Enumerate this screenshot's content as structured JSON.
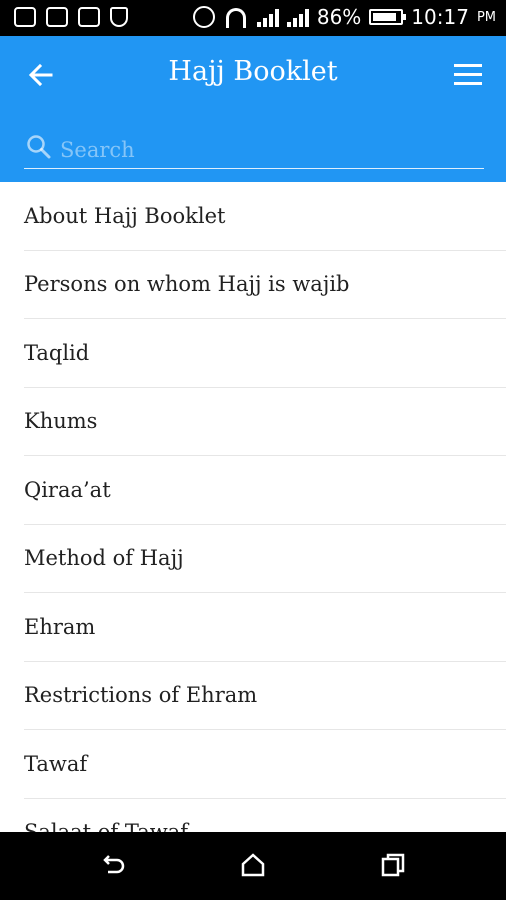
{
  "status_bar": {
    "battery_percent": "86%",
    "battery_level": 0.86,
    "time": "10:17",
    "ampm": "PM"
  },
  "app_bar": {
    "title": "Hajj Booklet",
    "search_placeholder": "Search",
    "accent_color": "#2196f3"
  },
  "list": {
    "items": [
      "About Hajj Booklet",
      "Persons on whom Hajj is wajib",
      "Taqlid",
      "Khums",
      "Qiraa’at",
      "Method of Hajj",
      "Ehram",
      "Restrictions of Ehram",
      "Tawaf",
      "Salaat of Tawaf"
    ]
  },
  "icons": {
    "back": "arrow-left-icon",
    "menu": "hamburger-menu-icon",
    "search": "search-icon",
    "nav_back": "nav-back-icon",
    "nav_home": "nav-home-icon",
    "nav_recents": "nav-recents-icon"
  }
}
